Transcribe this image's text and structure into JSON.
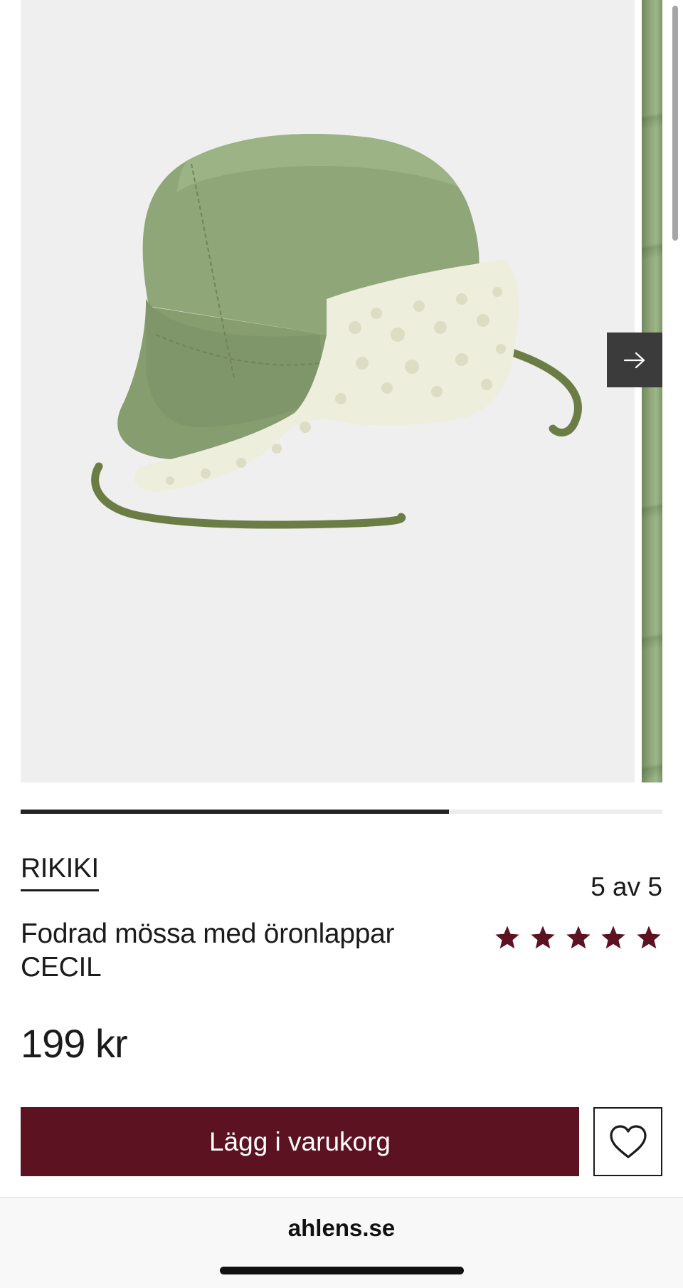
{
  "carousel": {
    "image_icon": "product-photo-hat",
    "next_icon": "arrow-right-icon",
    "current_slide": 2,
    "total_slides": 3,
    "progress_fraction": 0.667
  },
  "product": {
    "brand": "RIKIKI",
    "title": "Fodrad mössa med öronlappar CECIL",
    "rating_text": "5 av 5",
    "rating_value": 5,
    "rating_max": 5,
    "price": "199 kr"
  },
  "actions": {
    "add_to_cart_label": "Lägg i varukorg",
    "wishlist_icon": "heart-icon"
  },
  "browser": {
    "url": "ahlens.se"
  },
  "colors": {
    "accent": "#5c1220",
    "star": "#5c1220",
    "text": "#1b1b1b",
    "image_background": "#efefef"
  }
}
